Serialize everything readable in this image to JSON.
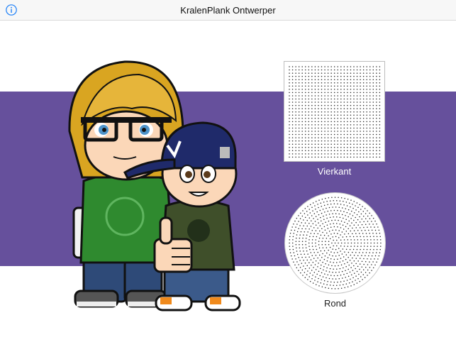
{
  "navbar": {
    "title": "KralenPlank Ontwerper",
    "info_icon": "info-icon"
  },
  "colors": {
    "accent": "#1a7ef7",
    "band": "#66509c",
    "navbar_bg": "#f7f7f7"
  },
  "boards": {
    "square": {
      "label": "Vierkant",
      "icon": "square-pegboard-icon"
    },
    "round": {
      "label": "Rond",
      "icon": "round-pegboard-icon"
    }
  }
}
